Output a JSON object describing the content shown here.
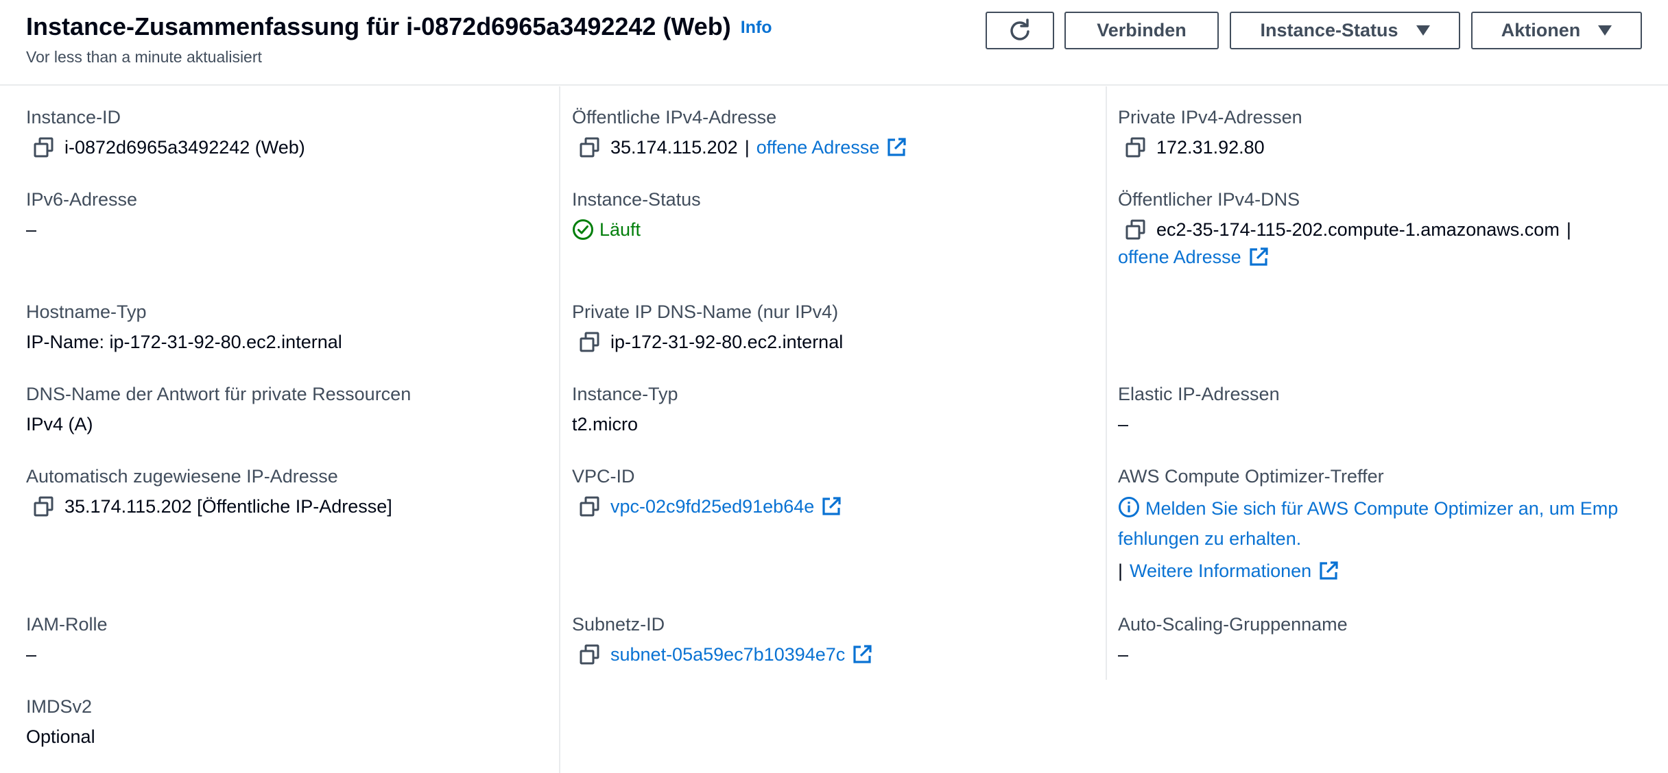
{
  "header": {
    "title": "Instance-Zusammenfassung für i-0872d6965a3492242 (Web)",
    "info": "Info",
    "subtitle": "Vor less than a minute aktualisiert",
    "buttons": {
      "connect": "Verbinden",
      "instance_state": "Instance-Status",
      "actions": "Aktionen"
    }
  },
  "col1": {
    "instance_id": {
      "label": "Instance-ID",
      "value": "i-0872d6965a3492242 (Web)"
    },
    "ipv6": {
      "label": "IPv6-Adresse",
      "value": "–"
    },
    "hostname_type": {
      "label": "Hostname-Typ",
      "value": "IP-Name: ip-172-31-92-80.ec2.internal"
    },
    "dns_answer": {
      "label": "DNS-Name der Antwort für private Ressourcen",
      "value": "IPv4 (A)"
    },
    "auto_ip": {
      "label": "Automatisch zugewiesene IP-Adresse",
      "value": "35.174.115.202 [Öffentliche IP-Adresse]"
    },
    "iam_role": {
      "label": "IAM-Rolle",
      "value": "–"
    },
    "imdsv2": {
      "label": "IMDSv2",
      "value": "Optional"
    }
  },
  "col2": {
    "public_ipv4": {
      "label": "Öffentliche IPv4-Adresse",
      "value": "35.174.115.202",
      "separator": "|",
      "link": "offene Adresse"
    },
    "instance_status": {
      "label": "Instance-Status",
      "value": "Läuft"
    },
    "private_dns": {
      "label": "Private IP DNS-Name (nur IPv4)",
      "value": "ip-172-31-92-80.ec2.internal"
    },
    "instance_type": {
      "label": "Instance-Typ",
      "value": "t2.micro"
    },
    "vpc_id": {
      "label": "VPC-ID",
      "value": "vpc-02c9fd25ed91eb64e"
    },
    "subnet_id": {
      "label": "Subnetz-ID",
      "value": "subnet-05a59ec7b10394e7c"
    }
  },
  "col3": {
    "private_ipv4": {
      "label": "Private IPv4-Adressen",
      "value": "172.31.92.80"
    },
    "public_dns": {
      "label": "Öffentlicher IPv4-DNS",
      "value": "ec2-35-174-115-202.compute-1.amazonaws.com",
      "separator": "|",
      "link": "offene Adresse"
    },
    "elastic_ip": {
      "label": "Elastic IP-Adressen",
      "value": "–"
    },
    "optimizer": {
      "label": "AWS Compute Optimizer-Treffer",
      "line1": "Melden Sie sich für AWS Compute Optimizer an, um Emp",
      "line2": "fehlungen zu erhalten.",
      "separator": "|",
      "more": "Weitere Informationen"
    },
    "asg": {
      "label": "Auto-Scaling-Gruppenname",
      "value": "–"
    }
  },
  "colors": {
    "link": "#0972d3",
    "success": "#037f0c",
    "label": "#414d5c",
    "text": "#000716",
    "divider": "#e9ebed"
  }
}
